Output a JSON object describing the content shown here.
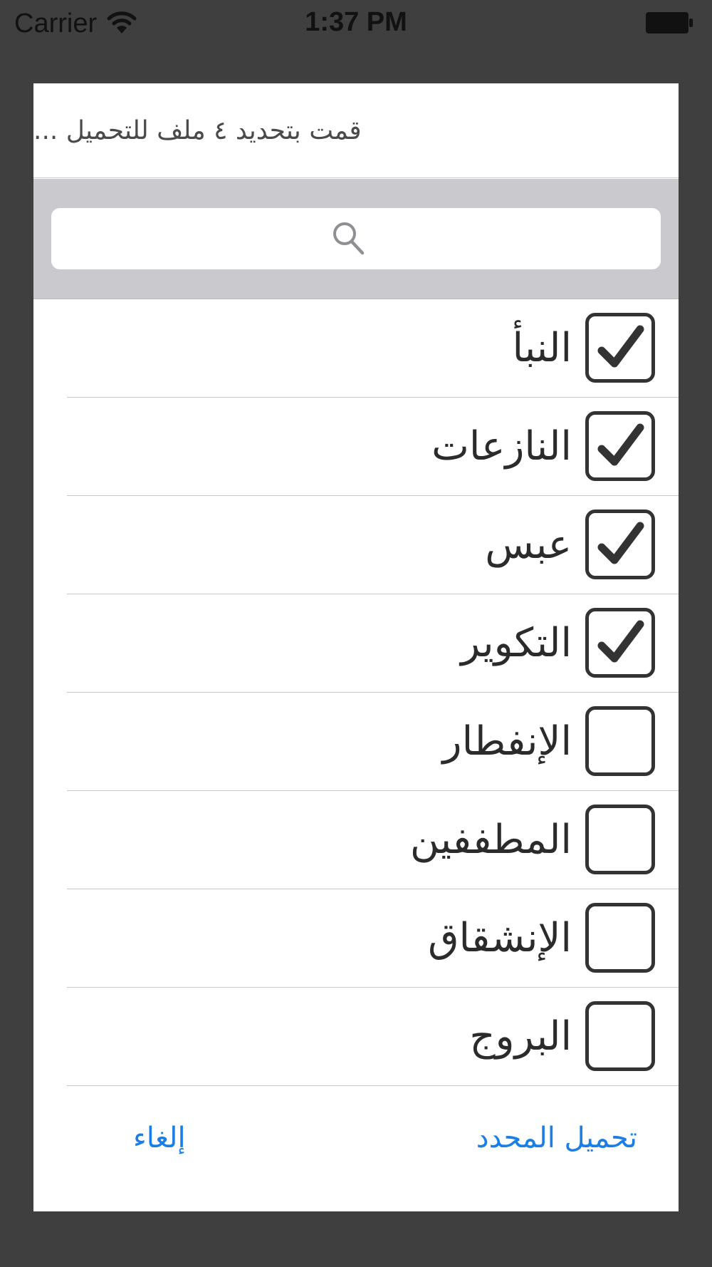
{
  "status_bar": {
    "carrier": "Carrier",
    "time": "1:37 PM"
  },
  "dialog": {
    "title": "قمت بتحديد ٤ ملف للتحميل ...",
    "search": {
      "placeholder": "",
      "icon": "search-icon"
    },
    "items": [
      {
        "label": "النبأ",
        "checked": true
      },
      {
        "label": "النازعات",
        "checked": true
      },
      {
        "label": "عبس",
        "checked": true
      },
      {
        "label": "التكوير",
        "checked": true
      },
      {
        "label": "الإنفطار",
        "checked": false
      },
      {
        "label": "المطففين",
        "checked": false
      },
      {
        "label": "الإنشقاق",
        "checked": false
      },
      {
        "label": "البروج",
        "checked": false
      }
    ],
    "buttons": {
      "download_selected": "تحميل المحدد",
      "cancel": "إلغاء"
    }
  },
  "colors": {
    "accent": "#1a7ee6",
    "backdrop": "#3f3f3f",
    "search_bg": "#c9c9ce"
  }
}
